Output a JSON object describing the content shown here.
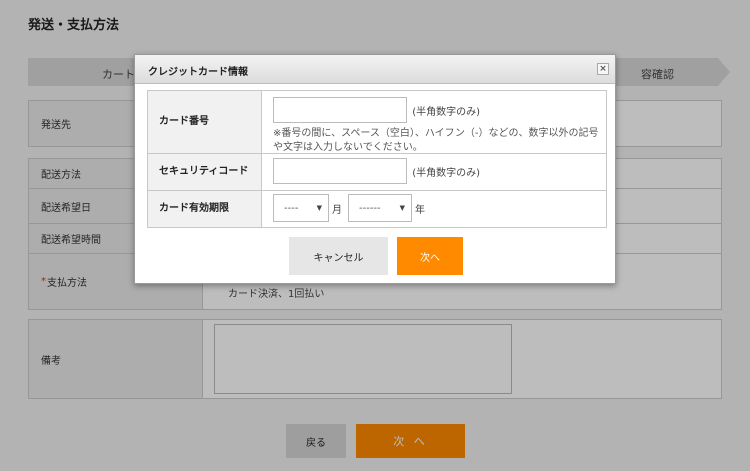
{
  "page": {
    "title": "発送・支払方法",
    "steps": {
      "left": "カート",
      "right": "容確認"
    },
    "rows": {
      "shipping_to": "発送先",
      "delivery_method": "配送方法",
      "delivery_date": "配送希望日",
      "delivery_time": "配送希望時間",
      "payment_required_mark": "*",
      "payment_method": "支払方法",
      "payment_value": "カード決済、1回払い",
      "remarks": "備考"
    },
    "buttons": {
      "back": "戻る",
      "next": "次 へ"
    }
  },
  "modal": {
    "title": "クレジットカード情報",
    "close": "×",
    "card_number": {
      "label": "カード番号",
      "value": "",
      "hint": "(半角数字のみ)",
      "note": "※番号の間に、スペース（空白）、ハイフン（-）などの、数字以外の記号や文字は入力しないでください。"
    },
    "security_code": {
      "label": "セキュリティコード",
      "value": "",
      "hint": "(半角数字のみ)"
    },
    "expiry": {
      "label": "カード有効期限",
      "month_value": "----",
      "month_unit": "月",
      "year_value": "------",
      "year_unit": "年"
    },
    "buttons": {
      "cancel": "キャンセル",
      "next": "次へ"
    }
  },
  "colors": {
    "accent": "#ff8a00",
    "required": "#e0302b"
  }
}
